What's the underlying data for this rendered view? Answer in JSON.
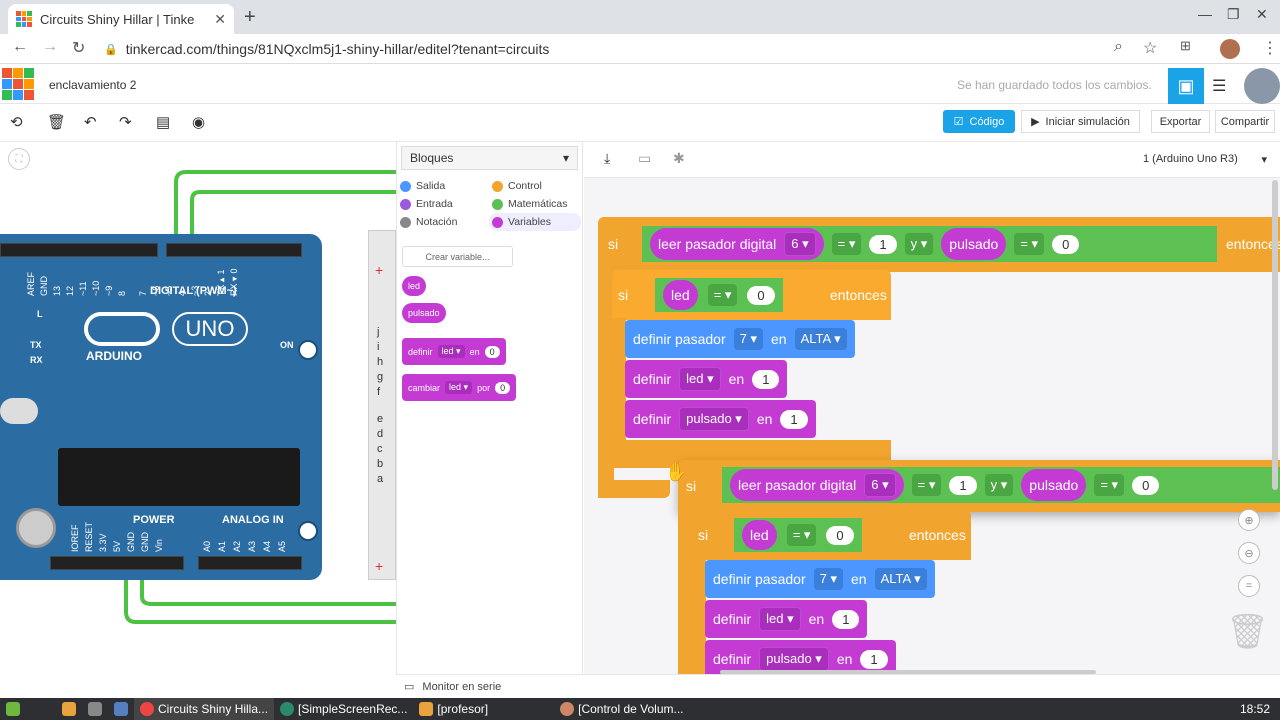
{
  "browser": {
    "tab_title": "Circuits Shiny Hillar | Tinke",
    "url": "tinkercad.com/things/81NQxclm5j1-shiny-hillar/editel?tenant=circuits"
  },
  "app": {
    "logo_letters": [
      "TIN",
      "KER",
      "CAD"
    ],
    "project_name": "enclavamiento 2",
    "saved_status": "Se han guardado todos los cambios."
  },
  "toolbar": {
    "code_label": "Código",
    "simulate_label": "Iniciar simulación",
    "export_label": "Exportar",
    "share_label": "Compartir"
  },
  "board": {
    "digital_label": "DIGITAL (PWM~)",
    "digital_pins": [
      "AREF",
      "GND",
      "13",
      "12",
      "~11",
      "~10",
      "~9",
      "8",
      "7",
      "~6",
      "~5",
      "4",
      "~3",
      "2",
      "TX▸1",
      "RX◂0"
    ],
    "logo_text": "ARDUINO",
    "model": "UNO",
    "on_label": "ON",
    "tx_label": "TX",
    "rx_label": "RX",
    "l_label": "L",
    "power_label": "POWER",
    "analog_label": "ANALOG IN",
    "power_pins": [
      "IOREF",
      "RESET",
      "3.3V",
      "5V",
      "GND",
      "GND",
      "Vin"
    ],
    "analog_pins": [
      "A0",
      "A1",
      "A2",
      "A3",
      "A4",
      "A5"
    ],
    "breadboard_letters": [
      "j",
      "i",
      "h",
      "g",
      "f",
      "e",
      "d",
      "c",
      "b",
      "a"
    ]
  },
  "palette": {
    "selector": "Bloques",
    "categories": [
      {
        "label": "Salida",
        "color": "#4c97ff"
      },
      {
        "label": "Control",
        "color": "#f2a52e"
      },
      {
        "label": "Entrada",
        "color": "#9b59e0"
      },
      {
        "label": "Matemáticas",
        "color": "#5cc152"
      },
      {
        "label": "Notación",
        "color": "#888888"
      },
      {
        "label": "Variables",
        "color": "#c43bd4"
      }
    ],
    "create_var": "Crear variable...",
    "var1": "led",
    "var2": "pulsado",
    "set_word": "definir",
    "set_var": "led",
    "set_in": "en",
    "set_val": "0",
    "change_word": "cambiar",
    "change_var": "led",
    "change_by": "por",
    "change_val": "0"
  },
  "workspace": {
    "board_selector": "1 (Arduino Uno R3)",
    "if_word": "si",
    "then_word": "entonces",
    "read_pin": "leer pasador digital",
    "pin6": "6",
    "eq": "=",
    "one": "1",
    "and_word": "y",
    "pulsado": "pulsado",
    "zero": "0",
    "led": "led",
    "set_pin": "definir pasador",
    "pin7": "7",
    "in_word": "en",
    "high": "ALTA",
    "define": "definir"
  },
  "serial_monitor": "Monitor en serie",
  "taskbar": {
    "items": [
      "Circuits Shiny Hilla...",
      "[SimpleScreenRec...",
      "[profesor]",
      "[Control de Volum..."
    ],
    "clock": "18:52"
  }
}
